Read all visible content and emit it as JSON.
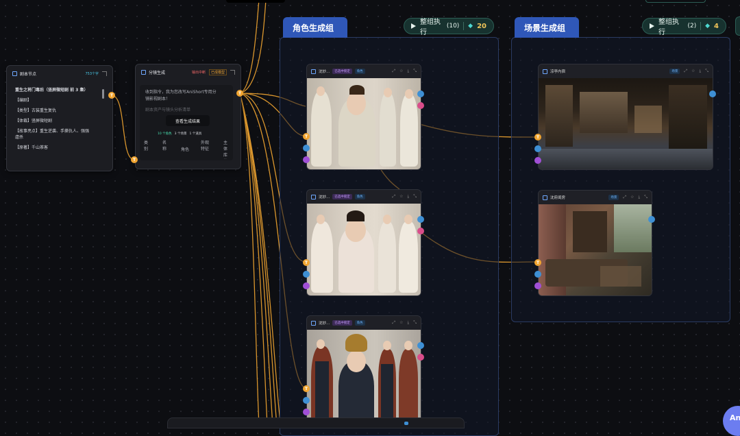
{
  "script_node": {
    "title": "剧本节点",
    "count": "753个字",
    "lines": [
      "重生之将门毒后（竖屏微短剧 前 3 集）",
      "【编剧】",
      "【类型】古装重生复仇",
      "【体裁】竖屏微短剧",
      "【故事亮点】重生逆袭、手撕仇人、强强",
      "虐杀",
      "【原著】千山茶客"
    ]
  },
  "shot_node": {
    "title": "分镜生成",
    "badge_output": "输出中断",
    "badge_mode": "已成模型",
    "text1": "收到指令，我为您改写AniShort专用分",
    "text2": "镜影视剧本！",
    "text3": "剧本资产与镜头分析清单",
    "view_button": "查看生成结果",
    "stats": {
      "roles": "10 个角色",
      "scenes": "3 个场景",
      "reqs": "1 个道具"
    },
    "table_headers": [
      "类别",
      "名称",
      "角色",
      "外观特征",
      "主体库状态"
    ]
  },
  "role_group": {
    "tab": "角色生成组",
    "exec_label": "整组执行",
    "exec_count": "(10)",
    "cost": "20",
    "cards": [
      {
        "title": "沈妙...",
        "tag_main": "已选中锁定",
        "tag_sub": "角色"
      },
      {
        "title": "沈妙...",
        "tag_main": "已选中锁定",
        "tag_sub": "角色"
      },
      {
        "title": "沈妙...",
        "tag_main": "已选中锁定",
        "tag_sub": "角色"
      }
    ]
  },
  "scene_group": {
    "tab": "场景生成组",
    "exec_label": "整组执行",
    "exec_count": "(2)",
    "cost": "4",
    "cards": [
      {
        "title": "凉亭内宿",
        "tag_sub": "场景"
      },
      {
        "title": "沈府闺房",
        "tag_sub": "场景"
      }
    ]
  },
  "ports": {
    "text_letter": "T"
  },
  "corner_button": "An",
  "colors": {
    "accent_blue": "#2f57b8",
    "wire": "#f1a531",
    "exec_bg": "#17322f",
    "cost": "#f0c55a"
  }
}
